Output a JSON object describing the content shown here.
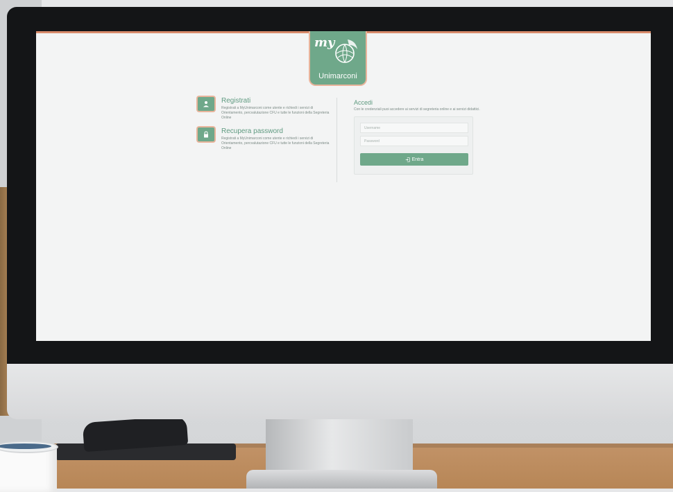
{
  "logo": {
    "my_text": "my",
    "brand_text": "Unimarconi"
  },
  "features": [
    {
      "icon": "user-icon",
      "title": "Registrati",
      "description": "Registrati a MyUnimarconi come utente e richiedi i servizi di Orientamento, percvalutazione CFU e tutte le funzioni della Segreteria Online"
    },
    {
      "icon": "lock-icon",
      "title": "Recupera password",
      "description": "Registrati a MyUnimarconi come utente e richiedi i servizi di Orientamento, percvalutazione CFU e tutte le funzioni della Segreteria Online"
    }
  ],
  "login": {
    "title": "Accedi",
    "description": "Con le credenziali puoi accedere ai servizi di segreteria online e ai servizi didattici.",
    "username_placeholder": "Username",
    "password_placeholder": "Password",
    "button_label": "Entra",
    "button_icon": "login-icon"
  },
  "colors": {
    "accent_green": "#6fa88a",
    "accent_salmon": "#e9b49b",
    "screen_bg": "#f3f4f4"
  }
}
